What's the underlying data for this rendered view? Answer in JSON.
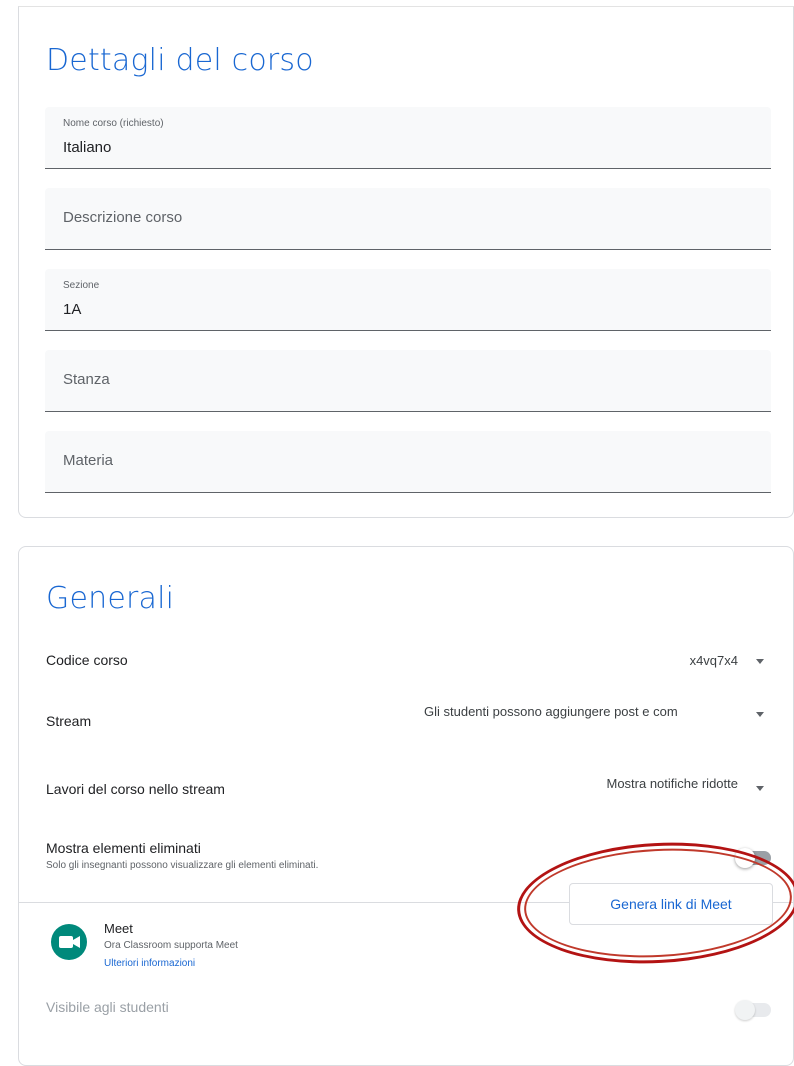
{
  "details": {
    "title": "Dettagli del corso",
    "fields": [
      {
        "label": "Nome corso (richiesto)",
        "value": "Italiano"
      },
      {
        "placeholder": "Descrizione corso"
      },
      {
        "label": "Sezione",
        "value": "1A"
      },
      {
        "placeholder": "Stanza"
      },
      {
        "placeholder": "Materia"
      }
    ]
  },
  "general": {
    "title": "Generali",
    "course_code": {
      "label": "Codice corso",
      "value": "x4vq7x4"
    },
    "stream": {
      "label": "Stream",
      "value": "Gli studenti possono aggiungere post e com"
    },
    "classwork": {
      "label": "Lavori del corso nello stream",
      "value": "Mostra notifiche ridotte"
    },
    "deleted": {
      "label": "Mostra elementi eliminati",
      "sublabel": "Solo gli insegnanti possono visualizzare gli elementi eliminati.",
      "enabled": false
    },
    "meet": {
      "title": "Meet",
      "subtitle": "Ora Classroom supporta Meet",
      "link": "Ulteriori informazioni",
      "button": "Genera link di Meet",
      "visible_label": "Visibile agli studenti",
      "visible_enabled": false
    }
  },
  "colors": {
    "accent": "#1967d2",
    "annotation": "#b31313",
    "meet_green": "#00897b"
  },
  "icons": [
    "meet-camera-icon",
    "dropdown-caret-icon"
  ]
}
